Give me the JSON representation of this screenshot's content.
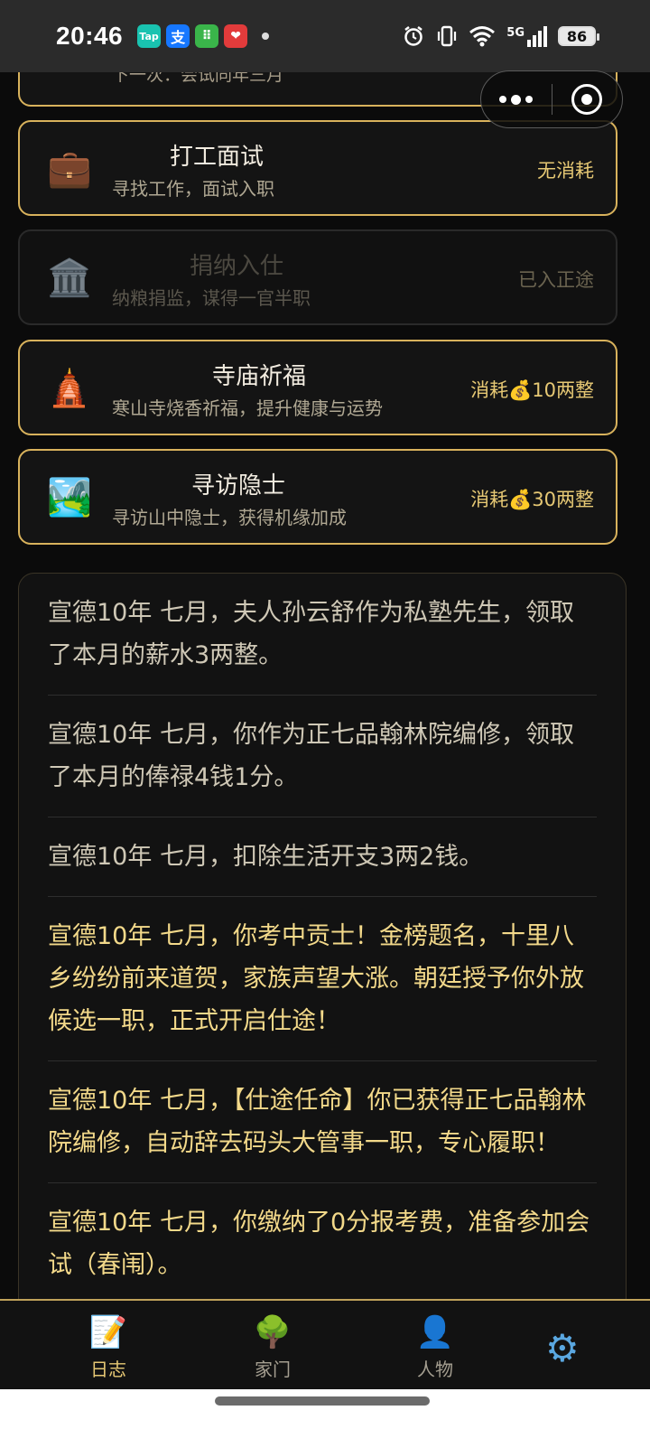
{
  "status_bar": {
    "time": "20:46",
    "apps": [
      "Tap",
      "支",
      "⠿",
      "❤"
    ],
    "network": "5G",
    "battery": "86"
  },
  "top_partial": {
    "subtitle": "下一次：会试同年三月"
  },
  "actions": [
    {
      "icon": "💼",
      "title": "打工面试",
      "subtitle": "寻找工作，面试入职",
      "cost": "无消耗",
      "enabled": true
    },
    {
      "icon": "🏛️",
      "title": "捐纳入仕",
      "subtitle": "纳粮捐监，谋得一官半职",
      "cost": "已入正途",
      "enabled": false
    },
    {
      "icon": "🛕",
      "title": "寺庙祈福",
      "subtitle": "寒山寺烧香祈福，提升健康与运势",
      "cost": "消耗💰10两整",
      "enabled": true
    },
    {
      "icon": "🏞️",
      "title": "寻访隐士",
      "subtitle": "寻访山中隐士，获得机缘加成",
      "cost": "消耗💰30两整",
      "enabled": true
    }
  ],
  "log": [
    {
      "text": "宣德10年 七月，夫人孙云舒作为私塾先生，领取了本月的薪水3两整。",
      "highlight": false
    },
    {
      "text": "宣德10年 七月，你作为正七品翰林院编修，领取了本月的俸禄4钱1分。",
      "highlight": false
    },
    {
      "text": "宣德10年 七月，扣除生活开支3两2钱。",
      "highlight": false
    },
    {
      "text": "宣德10年 七月，你考中贡士！金榜题名，十里八乡纷纷前来道贺，家族声望大涨。朝廷授予你外放候选一职，正式开启仕途！",
      "highlight": true
    },
    {
      "text": "宣德10年 七月，【仕途任命】你已获得正七品翰林院编修，自动辞去码头大管事一职，专心履职！",
      "highlight": true
    },
    {
      "text": "宣德10年 七月，你缴纳了0分报考费，准备参加会试（春闱）。",
      "highlight": true
    }
  ],
  "tabs": [
    {
      "icon": "📝",
      "label": "日志"
    },
    {
      "icon": "🌳",
      "label": "家门"
    },
    {
      "icon": "👤",
      "label": "人物"
    }
  ],
  "settings_icon": "⚙"
}
